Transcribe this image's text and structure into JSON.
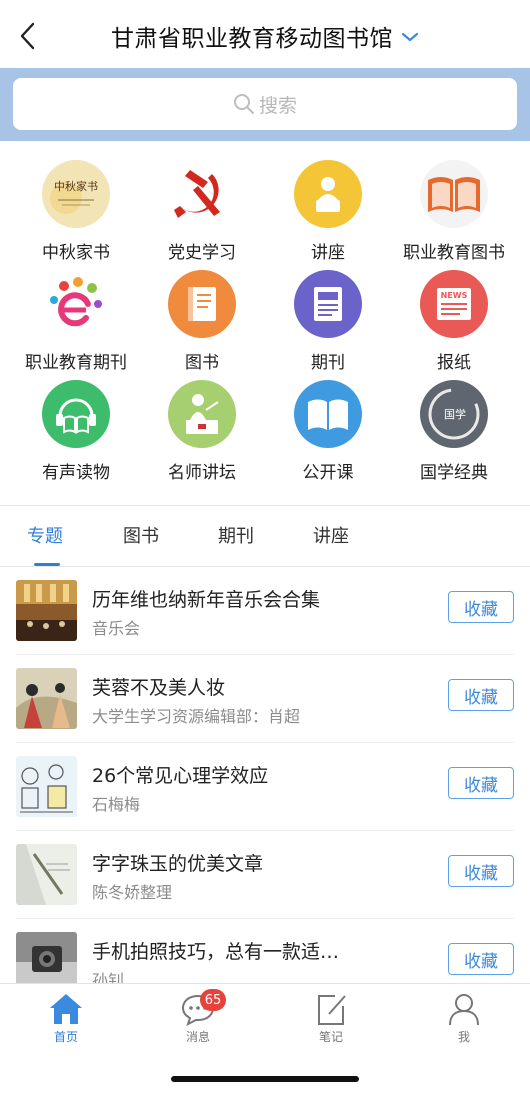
{
  "header": {
    "title": "甘肃省职业教育移动图书馆"
  },
  "search": {
    "placeholder": "搜索"
  },
  "colors": {
    "accent": "#2f7fd6",
    "search_band": "#a7c3e6",
    "badge": "#e8423c"
  },
  "categories": [
    {
      "label": "中秋家书",
      "icon": "mid-autumn-letter-icon",
      "icon_text": "中秋家书"
    },
    {
      "label": "党史学习",
      "icon": "hammer-sickle-icon"
    },
    {
      "label": "讲座",
      "icon": "lecture-icon"
    },
    {
      "label": "职业教育图书",
      "icon": "open-book-icon"
    },
    {
      "label": "职业教育期刊",
      "icon": "journal-logo-icon"
    },
    {
      "label": "图书",
      "icon": "book-icon"
    },
    {
      "label": "期刊",
      "icon": "magazine-icon"
    },
    {
      "label": "报纸",
      "icon": "newspaper-icon",
      "icon_text": "NEWS"
    },
    {
      "label": "有声读物",
      "icon": "audiobook-icon"
    },
    {
      "label": "名师讲坛",
      "icon": "teacher-icon"
    },
    {
      "label": "公开课",
      "icon": "open-course-icon"
    },
    {
      "label": "国学经典",
      "icon": "chinese-classics-icon",
      "icon_text": "国学"
    }
  ],
  "tabs": [
    "专题",
    "图书",
    "期刊",
    "讲座"
  ],
  "list": [
    {
      "title": "历年维也纳新年音乐会合集",
      "subtitle": "音乐会",
      "button": "收藏"
    },
    {
      "title": "芙蓉不及美人妆",
      "subtitle": "大学生学习资源编辑部：肖超",
      "button": "收藏"
    },
    {
      "title": "26个常见心理学效应",
      "subtitle": "石梅梅",
      "button": "收藏"
    },
    {
      "title": "字字珠玉的优美文章",
      "subtitle": "陈冬娇整理",
      "button": "收藏"
    },
    {
      "title": "手机拍照技巧，总有一款适…",
      "subtitle": "孙钊",
      "button": "收藏"
    }
  ],
  "bottom_nav": [
    {
      "label": "首页",
      "icon": "home-icon"
    },
    {
      "label": "消息",
      "icon": "message-icon",
      "badge": "65"
    },
    {
      "label": "笔记",
      "icon": "note-icon"
    },
    {
      "label": "我",
      "icon": "profile-icon"
    }
  ]
}
